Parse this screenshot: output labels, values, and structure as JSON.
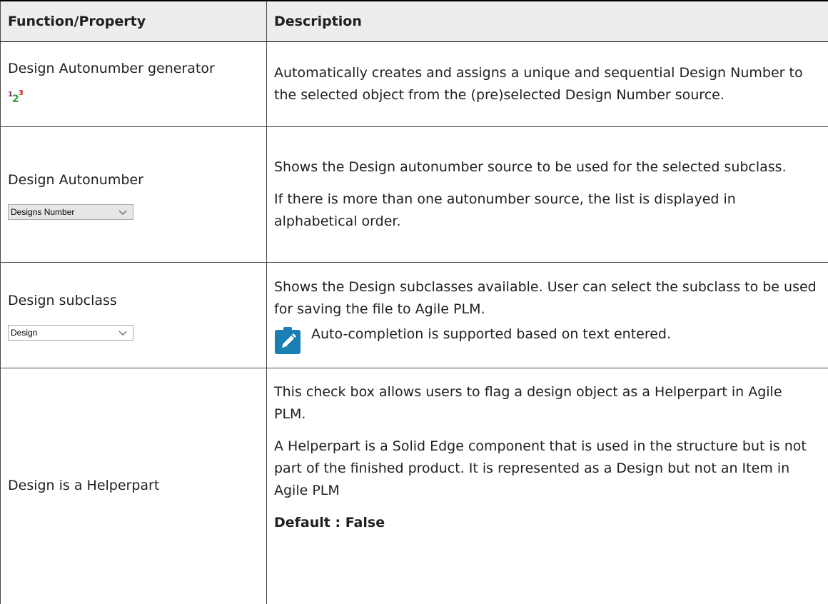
{
  "table": {
    "headers": {
      "function": "Function/Property",
      "description": "Description"
    },
    "rows": [
      {
        "function": "Design Autonumber generator",
        "icon": {
          "name": "autonumber-icon",
          "glyphs": [
            "1",
            "2",
            "3"
          ]
        },
        "description": [
          "Automatically creates and assigns a unique and sequential Design Number to the selected object from the (pre)selected Design Number source."
        ]
      },
      {
        "function": "Design Autonumber",
        "control": {
          "type": "dropdown",
          "value": "Designs Number"
        },
        "description": [
          "Shows the Design autonumber source to be used for the selected subclass.",
          "If there is more than one autonumber source, the list is displayed in alphabetical order."
        ]
      },
      {
        "function": "Design subclass",
        "control": {
          "type": "dropdown",
          "value": "Design"
        },
        "description": [
          "Shows the Design subclasses available. User can select the subclass to be used for saving the file to Agile PLM."
        ],
        "note": {
          "icon": "pencil-note-icon",
          "text": "Auto-completion is supported based on text entered."
        }
      },
      {
        "function": "Design is a Helperpart",
        "description": [
          "This check box allows users to flag a design object as a Helperpart in Agile PLM.",
          "A Helperpart is a Solid Edge component that is used in the structure but is not part of the finished product. It is represented as a Design but not an Item in Agile PLM"
        ],
        "default": "Default : False"
      }
    ]
  },
  "colors": {
    "header_bg": "#ededed",
    "border": "#4a4a4a",
    "note_icon": "#1a7fb3"
  }
}
